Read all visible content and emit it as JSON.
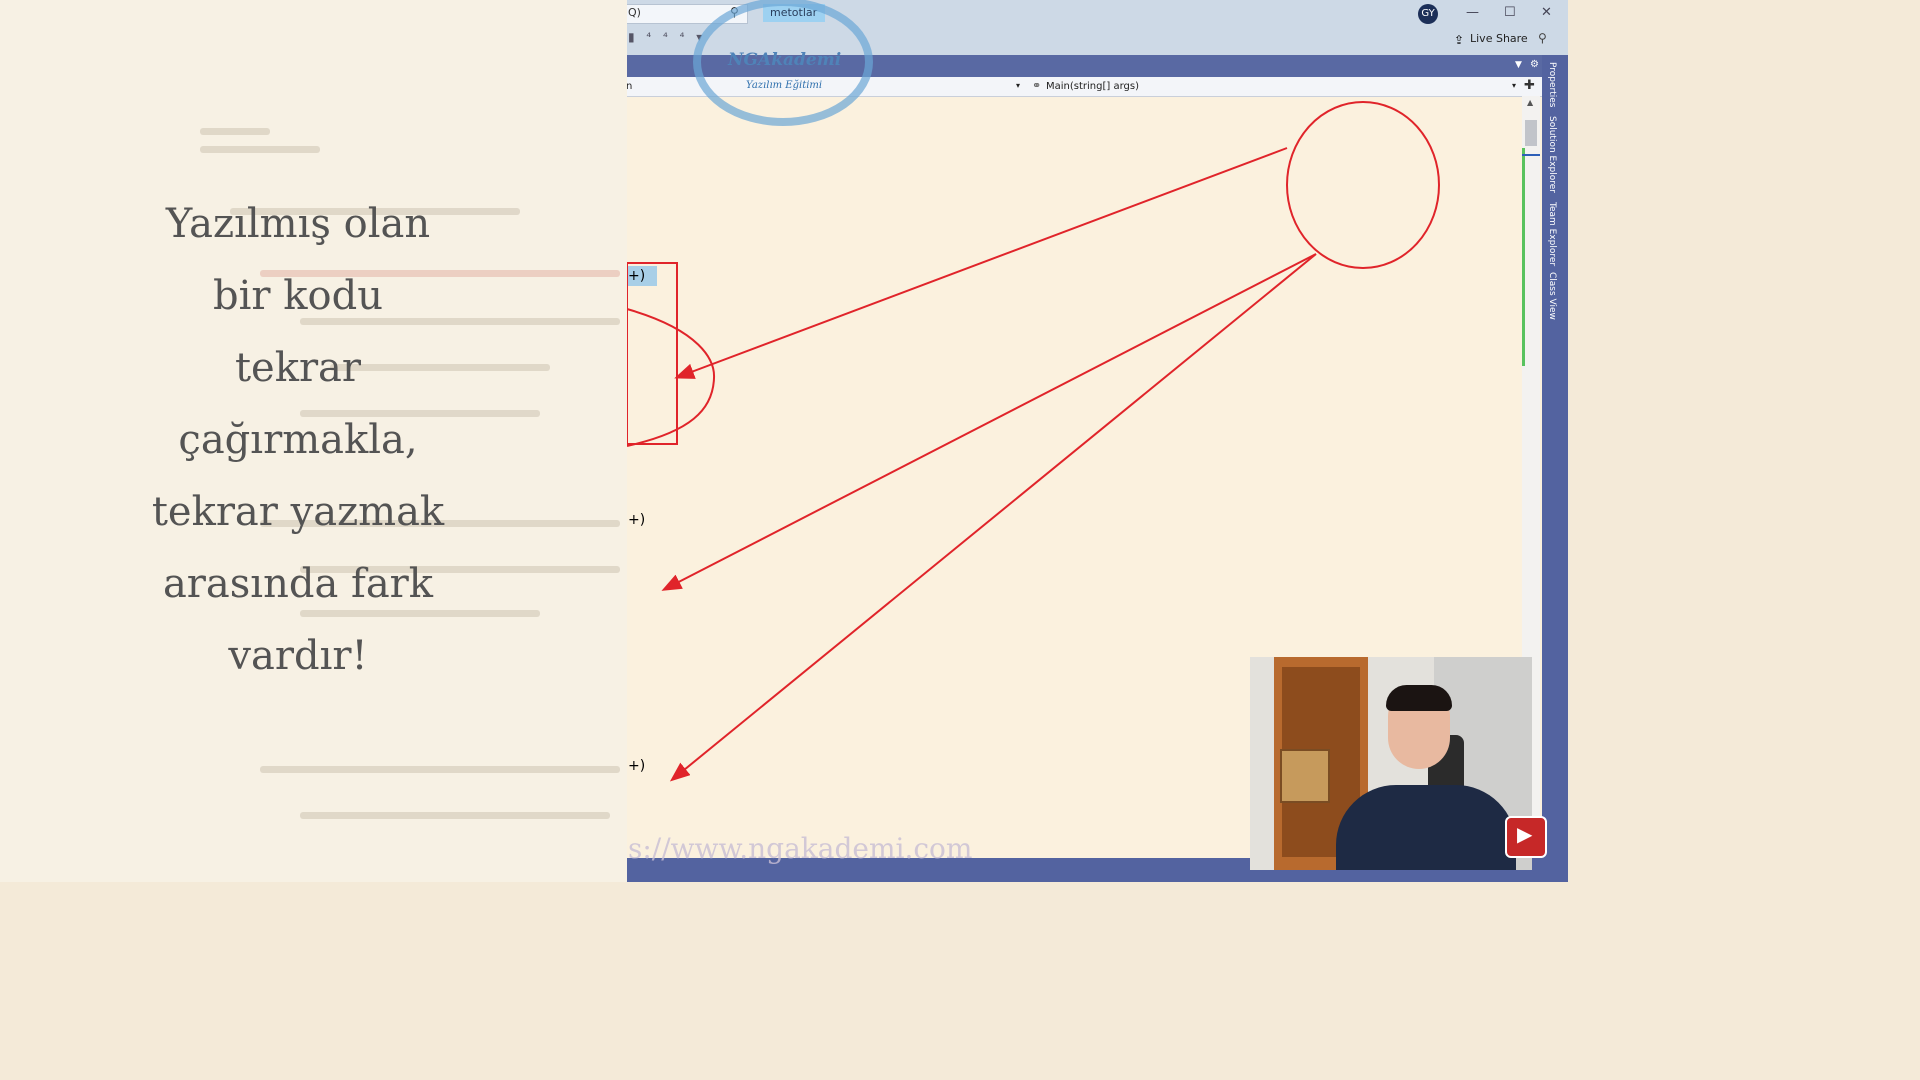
{
  "toolbar": {
    "search_text": "Q)",
    "project_label": "metotlar",
    "avatar_initials": "GY",
    "live_share_label": "Live Share"
  },
  "navbar": {
    "left_label": "n",
    "method_label": "Main(string[] args)"
  },
  "side_tabs": [
    "Properties",
    "Solution Explorer",
    "Team Explorer",
    "Class View"
  ],
  "code_fragments": [
    "+)",
    "+)",
    "+)"
  ],
  "logo": {
    "line1": "NGAkademi",
    "line2": "Yazılım Eğitimi"
  },
  "watermark": "s://www.ngakademi.com",
  "overlay": {
    "text": "Yazılmış olan\nbir kodu\ntekrar\nçağırmakla,\ntekrar yazmak\narasında fark\nvardır!"
  },
  "colors": {
    "annotation_red": "#e0242a",
    "ide_band": "#5363a0"
  },
  "icons": [
    "search-icon",
    "user-avatar",
    "minimize-icon",
    "maximize-icon",
    "close-icon",
    "share-icon",
    "pin-icon",
    "gear-icon",
    "play-icon"
  ]
}
